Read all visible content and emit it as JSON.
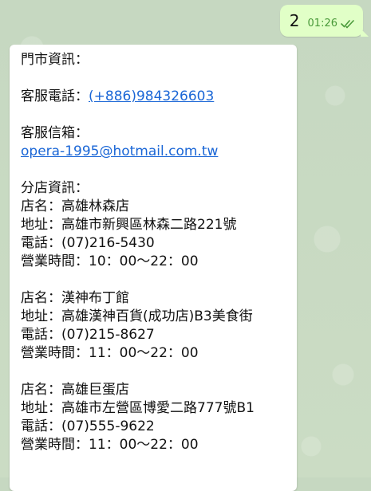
{
  "outgoing_message": {
    "text": "2",
    "time": "01:26",
    "status_icon": "double-check-icon",
    "colors": {
      "bubble": "#e1ffc7",
      "time": "#4a9a3a"
    }
  },
  "incoming_message": {
    "store_info_title": "門市資訊：",
    "service_phone_label": "客服電話：",
    "service_phone_link": "(+886)984326603",
    "service_email_label": "客服信箱：",
    "service_email_link": "opera-1995@hotmail.com.tw",
    "branches_title": "分店資訊：",
    "branches": [
      {
        "name": "店名：高雄林森店",
        "address": "地址：高雄市新興區林森二路221號",
        "phone": "電話：(07)216-5430",
        "hours": "營業時間：10：00～22：00"
      },
      {
        "name": "店名：漢神布丁館",
        "address": "地址：高雄漢神百貨(成功店)B3美食街",
        "phone": "電話：(07)215-8627",
        "hours": "營業時間：11：00～22：00"
      },
      {
        "name": "店名：高雄巨蛋店",
        "address": "地址：高雄市左營區博愛二路777號B1",
        "phone": "電話：(07)555-9622",
        "hours": "營業時間：11：00～22：00"
      }
    ],
    "colors": {
      "link": "#1a66d6",
      "bubble": "#ffffff"
    }
  },
  "background": {
    "color": "#c8d9c3"
  }
}
